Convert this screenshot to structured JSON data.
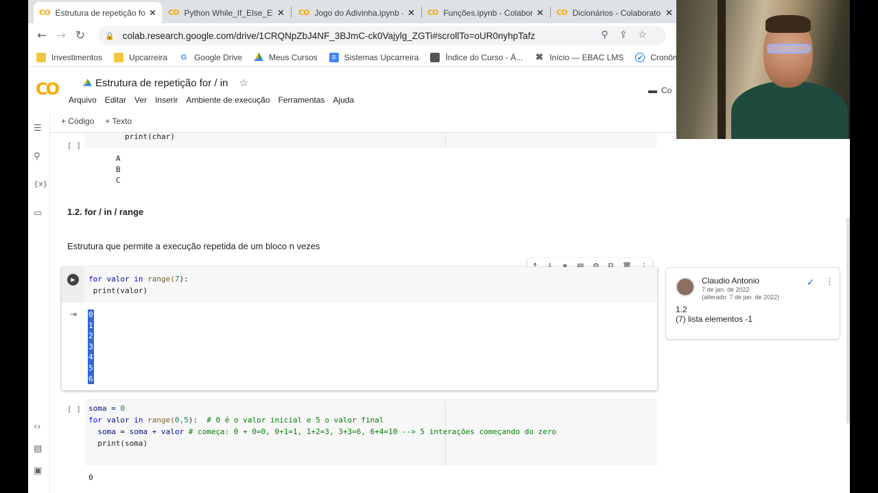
{
  "tabs": [
    {
      "title": "Estrutura de repetição for"
    },
    {
      "title": "Python While_If_Else_Elif"
    },
    {
      "title": "Jogo do Adivinha.ipynb -"
    },
    {
      "title": "Funções.ipynb - Colabora"
    },
    {
      "title": "Dicionários - Colaborator"
    }
  ],
  "address": {
    "url": "colab.research.google.com/drive/1CRQNpZbJ4NF_3BJmC-ck0Vajylg_ZGTi#scrollTo=oUR0nyhpTafz"
  },
  "bookmarks": [
    {
      "label": "Investimentos"
    },
    {
      "label": "Upcarreira"
    },
    {
      "label": "Google Drive"
    },
    {
      "label": "Meus Cursos"
    },
    {
      "label": "Sistemas Upcarreira"
    },
    {
      "label": "Índice do Curso - Á..."
    },
    {
      "label": "Início — EBAC LMS"
    },
    {
      "label": "Cronômetro online..."
    }
  ],
  "colab": {
    "logo": "CO",
    "title": "Estrutura de repetição for / in",
    "comment_label": "Co",
    "menu": [
      "Arquivo",
      "Editar",
      "Ver",
      "Inserir",
      "Ambiente de execução",
      "Ferramentas",
      "Ajuda"
    ],
    "toolbar": {
      "code": "+ Código",
      "text": "+ Texto"
    }
  },
  "cells": {
    "prev_code": "print(char)",
    "prev_bracket": "[ ]",
    "prev_output": [
      "A",
      "B",
      "C"
    ],
    "heading": "1.2. for / in / range",
    "description": "Estrutura que permite a execução repetida de um bloco n vezes",
    "active_line1_kw": "for",
    "active_line1_var": " valor ",
    "active_line1_in": "in",
    "active_line1_fn": " range(",
    "active_line1_num": "7",
    "active_line1_end": "):",
    "active_line2": " print(valor)",
    "active_output": [
      "0",
      "1",
      "2",
      "3",
      "4",
      "5",
      "6"
    ],
    "next_bracket": "[ ]",
    "next_l1": "soma = ",
    "next_l1_num": "0",
    "next_l2_a": "for",
    "next_l2_b": " valor ",
    "next_l2_c": "in",
    "next_l2_d": " range(",
    "next_l2_e": "0,5",
    "next_l2_f": "):  ",
    "next_l2_cm": "# 0 é o valor inicial e 5 o valor final",
    "next_l3": "  soma = soma + valor ",
    "next_l3_cm": "# começa: 0 + 0=0, 0+1=1, 1+2=3, 3+3=6, 6+4=10 --> 5 interações começando do zero",
    "next_l4": "  print(soma)",
    "next_output": "0"
  },
  "comment": {
    "author": "Claudio Antonio",
    "date": "7 de jan. de 2022",
    "edited": "(alterado: 7 de jan. de 2022)",
    "line1": "1.2",
    "line2": "(7) lista elementos -1"
  },
  "colors": {
    "accent": "#f9ab00",
    "selection": "#3367d6",
    "check": "#1a73e8"
  }
}
